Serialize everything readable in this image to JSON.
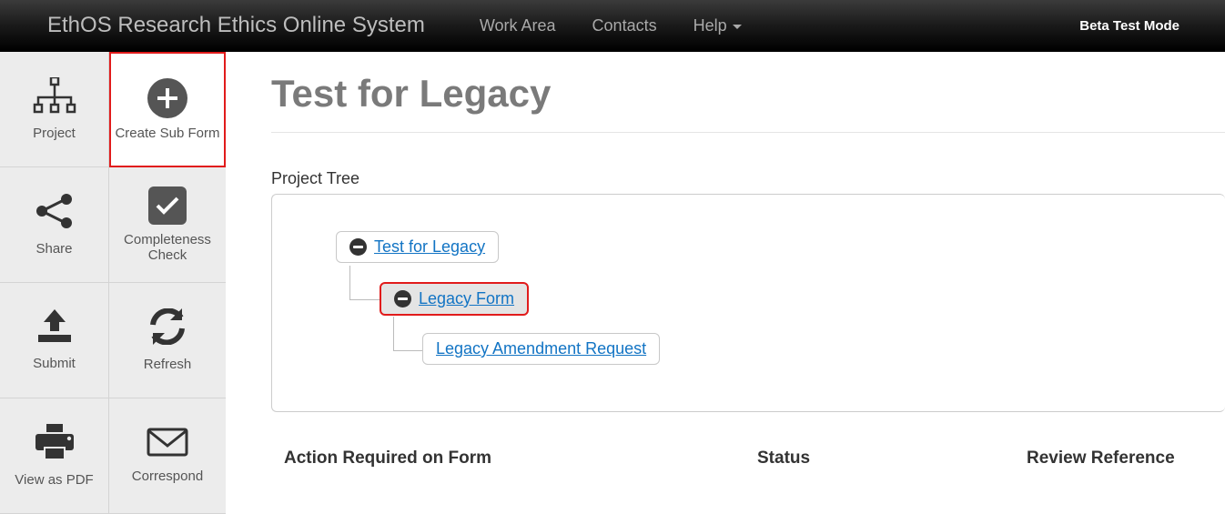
{
  "nav": {
    "brand": "EthOS Research Ethics Online System",
    "links": [
      "Work Area",
      "Contacts",
      "Help"
    ],
    "mode": "Beta Test Mode"
  },
  "sidebar": [
    {
      "label": "Project"
    },
    {
      "label": "Create Sub Form",
      "highlight": true
    },
    {
      "label": "Share"
    },
    {
      "label": "Completeness Check"
    },
    {
      "label": "Submit"
    },
    {
      "label": "Refresh"
    },
    {
      "label": "View as PDF"
    },
    {
      "label": "Correspond"
    }
  ],
  "page": {
    "title": "Test for Legacy",
    "tree_label": "Project Tree",
    "nodes": {
      "root": "Test for Legacy",
      "child": "Legacy Form",
      "grandchild": "Legacy Amendment Request"
    },
    "columns": {
      "action": "Action Required on Form",
      "status": "Status",
      "review": "Review Reference"
    }
  }
}
